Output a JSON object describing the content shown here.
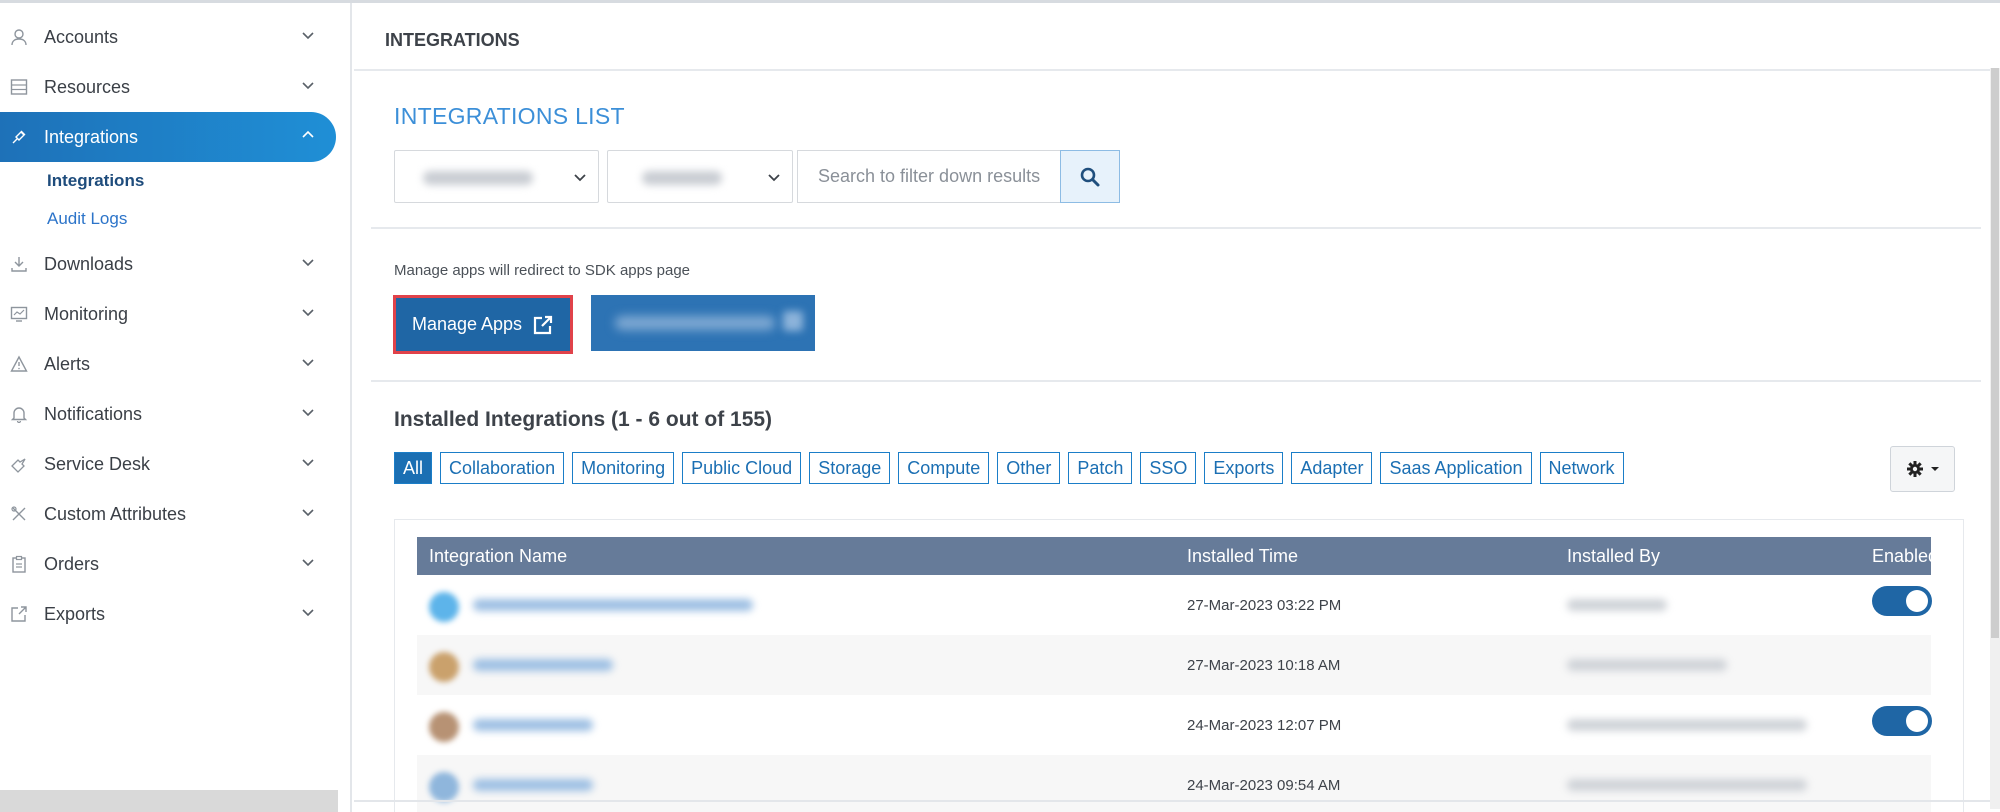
{
  "sidebar": {
    "items": [
      {
        "label": "Accounts",
        "icon": "user-icon"
      },
      {
        "label": "Resources",
        "icon": "server-icon"
      },
      {
        "label": "Integrations",
        "icon": "plug-icon"
      },
      {
        "label": "Downloads",
        "icon": "download-icon"
      },
      {
        "label": "Monitoring",
        "icon": "chart-icon"
      },
      {
        "label": "Alerts",
        "icon": "warning-icon"
      },
      {
        "label": "Notifications",
        "icon": "bell-icon"
      },
      {
        "label": "Service Desk",
        "icon": "ticket-icon"
      },
      {
        "label": "Custom Attributes",
        "icon": "tools-icon"
      },
      {
        "label": "Orders",
        "icon": "clipboard-icon"
      },
      {
        "label": "Exports",
        "icon": "export-icon"
      }
    ],
    "sub_items": [
      {
        "label": "Integrations"
      },
      {
        "label": "Audit Logs"
      }
    ]
  },
  "header": {
    "title": "INTEGRATIONS"
  },
  "list_section": {
    "title": "INTEGRATIONS  LIST",
    "search_placeholder": "Search to filter down results"
  },
  "manage": {
    "note": "Manage apps will redirect to SDK apps page",
    "manage_apps_label": "Manage Apps"
  },
  "installed": {
    "title": "Installed Integrations (1 - 6 out of 155)",
    "filters": [
      "All",
      "Collaboration",
      "Monitoring",
      "Public Cloud",
      "Storage",
      "Compute",
      "Other",
      "Patch",
      "SSO",
      "Exports",
      "Adapter",
      "Saas Application",
      "Network"
    ],
    "active_filter": "All"
  },
  "table": {
    "columns": [
      "Integration Name",
      "Installed Time",
      "Installed By",
      "Enabled"
    ],
    "rows": [
      {
        "installed_time": "27-Mar-2023 03:22 PM",
        "enabled": true
      },
      {
        "installed_time": "27-Mar-2023 10:18 AM",
        "enabled": null
      },
      {
        "installed_time": "24-Mar-2023 12:07 PM",
        "enabled": true
      },
      {
        "installed_time": "24-Mar-2023 09:54 AM",
        "enabled": null
      }
    ]
  },
  "colors": {
    "accent": "#1b6fb3",
    "active_nav": "#1e7bc4",
    "table_header": "#667b99",
    "highlight_border": "#e0424a"
  }
}
